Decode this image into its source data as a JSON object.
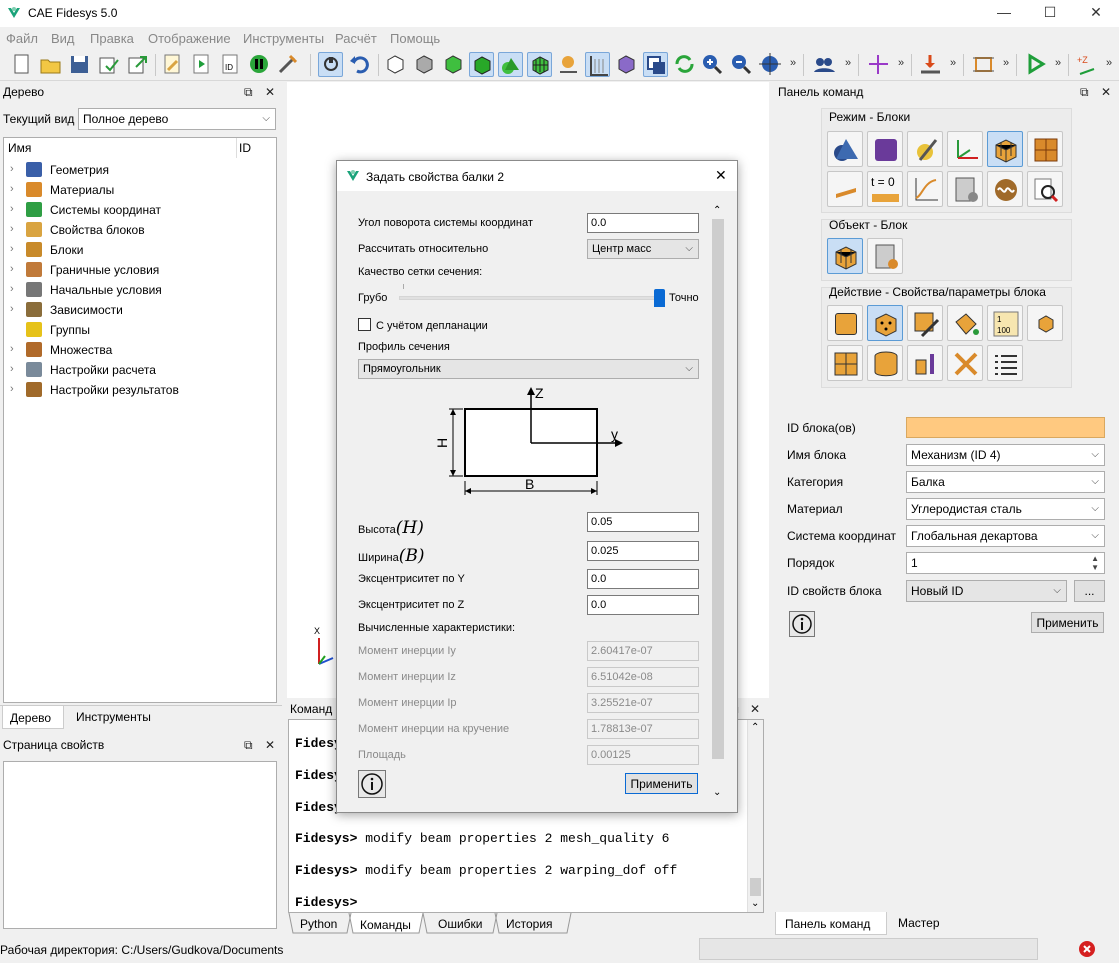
{
  "app": {
    "title": "CAE Fidesys 5.0"
  },
  "menu": [
    "Файл",
    "Вид",
    "Правка",
    "Отображение",
    "Инструменты",
    "Расчёт",
    "Помощь"
  ],
  "tree_panel": {
    "title": "Дерево",
    "view_label": "Текущий вид",
    "view_value": "Полное дерево",
    "col_name": "Имя",
    "col_id": "ID",
    "items": [
      {
        "label": "Геометрия",
        "icon": "geometry-icon",
        "color": "#3a5fa8"
      },
      {
        "label": "Материалы",
        "icon": "materials-icon",
        "color": "#d98a2b"
      },
      {
        "label": "Системы координат",
        "icon": "coordinate-system-icon",
        "color": "#2f9e44"
      },
      {
        "label": "Свойства блоков",
        "icon": "block-properties-icon",
        "color": "#d9a441"
      },
      {
        "label": "Блоки",
        "icon": "blocks-icon",
        "color": "#c88a2a"
      },
      {
        "label": "Граничные условия",
        "icon": "boundary-conditions-icon",
        "color": "#c07a3a"
      },
      {
        "label": "Начальные условия",
        "icon": "initial-conditions-icon",
        "color": "#777777"
      },
      {
        "label": "Зависимости",
        "icon": "dependencies-icon",
        "color": "#8a6d3b"
      },
      {
        "label": "Группы",
        "icon": "groups-icon",
        "color": "#e6c21a"
      },
      {
        "label": "Множества",
        "icon": "sets-icon",
        "color": "#b06a2a"
      },
      {
        "label": "Настройки расчета",
        "icon": "calc-settings-icon",
        "color": "#7a8a9a"
      },
      {
        "label": "Настройки результатов",
        "icon": "results-settings-icon",
        "color": "#a06a2a"
      }
    ],
    "tabs": [
      "Дерево",
      "Инструменты"
    ]
  },
  "props_panel": {
    "title": "Страница свойств"
  },
  "command_panel": {
    "title": "Команд",
    "lines": [
      {
        "prompt": "Fidesys",
        "text": ""
      },
      {
        "prompt": "Fidesy",
        "text": ""
      },
      {
        "prompt": "Fidesy",
        "text": ""
      },
      {
        "prompt": "Fidesys>",
        "text": " modify beam properties 2 mesh_quality 6"
      },
      {
        "prompt": "Fidesys>",
        "text": " modify beam properties 2 warping_dof off"
      },
      {
        "prompt": "Fidesys>",
        "text": ""
      }
    ],
    "tabs": [
      "Python",
      "Команды",
      "Ошибки",
      "История"
    ]
  },
  "right_panel": {
    "title": "Панель команд",
    "mode_label": "Режим - Блоки",
    "object_label": "Объект - Блок",
    "action_label": "Действие - Свойства/параметры блока",
    "t0_label": "t = 0",
    "fields": {
      "block_id_label": "ID блока(ов)",
      "block_id_value": "",
      "block_name_label": "Имя блока",
      "block_name_value": "Механизм (ID 4)",
      "category_label": "Категория",
      "category_value": "Балка",
      "material_label": "Материал",
      "material_value": "Углеродистая сталь",
      "coord_label": "Система координат",
      "coord_value": "Глобальная декартова",
      "order_label": "Порядок",
      "order_value": "1",
      "props_id_label": "ID свойств блока",
      "props_id_value": "Новый ID",
      "dots_label": "...",
      "apply_label": "Применить"
    },
    "tabs": [
      "Панель команд",
      "Мастер"
    ]
  },
  "dialog": {
    "title": "Задать свойства балки 2",
    "rot_label": "Угол поворота системы координат",
    "rot_value": "0.0",
    "relative_label": "Рассчитать относительно",
    "relative_value": "Центр масс",
    "mesh_quality_label": "Качество сетки сечения:",
    "coarse_label": "Грубо",
    "fine_label": "Точно",
    "mesh_quality_fraction": 1.0,
    "warping_label": "С учётом депланации",
    "warping_checked": false,
    "profile_label": "Профиль сечения",
    "profile_value": "Прямоугольник",
    "diagram": {
      "z": "Z",
      "y": "y",
      "h": "H",
      "b": "B"
    },
    "height_label": "Высота",
    "height_sym": "(H)",
    "height_value": "0.05",
    "width_label": "Ширина",
    "width_sym": "(B)",
    "width_value": "0.025",
    "ecc_y_label": "Эксцентриситет по Y",
    "ecc_y_value": "0.0",
    "ecc_z_label": "Эксцентриситет по Z",
    "ecc_z_value": "0.0",
    "computed_label": "Вычисленные характеристики:",
    "iy_label": "Момент инерции Iy",
    "iy_value": "2.60417e-07",
    "iz_label": "Момент инерции Iz",
    "iz_value": "6.51042e-08",
    "ip_label": "Момент инерции Ip",
    "ip_value": "3.25521e-07",
    "it_label": "Момент инерции на кручение",
    "it_value": "1.78813e-07",
    "area_label": "Площадь",
    "area_value": "0.00125",
    "apply_label": "Применить"
  },
  "status": {
    "workdir": "Рабочая директория: C:/Users/Gudkova/Documents"
  }
}
